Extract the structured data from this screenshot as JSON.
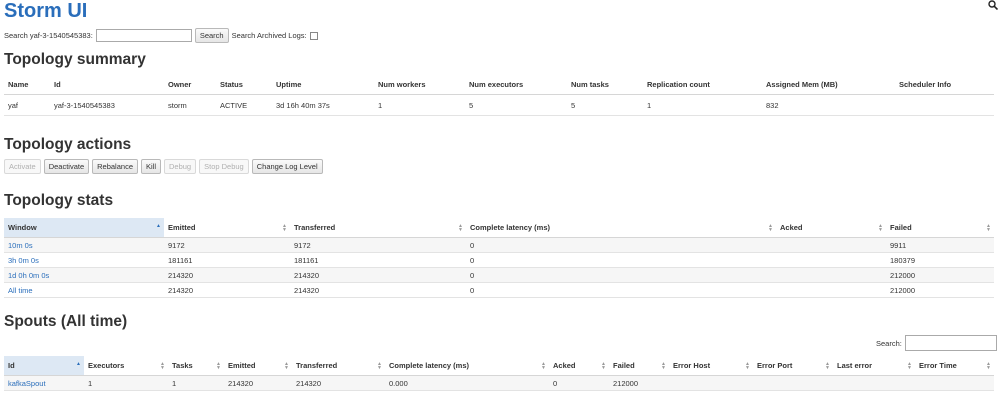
{
  "header": {
    "brand": "Storm UI"
  },
  "search_bar": {
    "label": "Search yaf-3-1540545383:",
    "button_label": "Search",
    "archived_label": "Search Archived Logs:"
  },
  "topology_summary": {
    "title": "Topology summary",
    "columns": [
      "Name",
      "Id",
      "Owner",
      "Status",
      "Uptime",
      "Num workers",
      "Num executors",
      "Num tasks",
      "Replication count",
      "Assigned Mem (MB)",
      "Scheduler Info"
    ],
    "rows": [
      [
        "yaf",
        "yaf-3-1540545383",
        "storm",
        "ACTIVE",
        "3d 16h 40m 37s",
        "1",
        "5",
        "5",
        "1",
        "832",
        ""
      ]
    ]
  },
  "topology_actions": {
    "title": "Topology actions",
    "buttons": [
      {
        "label": "Activate",
        "disabled": true
      },
      {
        "label": "Deactivate",
        "disabled": false
      },
      {
        "label": "Rebalance",
        "disabled": false
      },
      {
        "label": "Kill",
        "disabled": false
      },
      {
        "label": "Debug",
        "disabled": true
      },
      {
        "label": "Stop Debug",
        "disabled": true
      },
      {
        "label": "Change Log Level",
        "disabled": false
      }
    ]
  },
  "topology_stats": {
    "title": "Topology stats",
    "columns": [
      "Window",
      "Emitted",
      "Transferred",
      "Complete latency (ms)",
      "Acked",
      "Failed"
    ],
    "rows": [
      [
        "10m 0s",
        "9172",
        "9172",
        "0",
        "",
        "9911"
      ],
      [
        "3h 0m 0s",
        "181161",
        "181161",
        "0",
        "",
        "180379"
      ],
      [
        "1d 0h 0m 0s",
        "214320",
        "214320",
        "0",
        "",
        "212000"
      ],
      [
        "All time",
        "214320",
        "214320",
        "0",
        "",
        "212000"
      ]
    ]
  },
  "spouts": {
    "title": "Spouts (All time)",
    "search_label": "Search:",
    "columns": [
      "Id",
      "Executors",
      "Tasks",
      "Emitted",
      "Transferred",
      "Complete latency (ms)",
      "Acked",
      "Failed",
      "Error Host",
      "Error Port",
      "Last error",
      "Error Time"
    ],
    "rows": [
      [
        "kafkaSpout",
        "1",
        "1",
        "214320",
        "214320",
        "0.000",
        "0",
        "212000",
        "",
        "",
        "",
        ""
      ]
    ]
  }
}
